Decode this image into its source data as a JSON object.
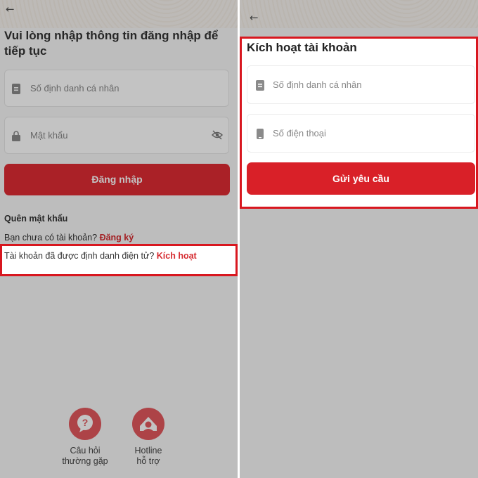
{
  "left": {
    "title": "Vui lòng nhập thông tin đăng nhập để tiếp tục",
    "id_placeholder": "Số định danh cá nhân",
    "password_placeholder": "Mật khẩu",
    "login_button": "Đăng nhập",
    "forgot_password": "Quên mật khẩu",
    "no_account_text": "Bạn chưa có tài khoản?",
    "register_link": "Đăng ký",
    "identified_text": "Tài khoản đã được định danh điện tử?",
    "activate_link": "Kích hoạt",
    "faq_line1": "Câu hỏi",
    "faq_line2": "thường gặp",
    "hotline_line1": "Hotline",
    "hotline_line2": "hỗ trợ"
  },
  "right": {
    "title": "Kích hoạt tài khoản",
    "id_placeholder": "Số định danh cá nhân",
    "phone_placeholder": "Số điện thoại",
    "submit_button": "Gửi yêu cầu"
  },
  "icons": {
    "back": "back-arrow-icon",
    "id_card": "id-card-icon",
    "lock": "lock-icon",
    "eye_off": "eye-off-icon",
    "phone": "phone-icon",
    "faq": "question-bubble-icon",
    "hotline": "headset-icon"
  },
  "colors": {
    "primary_red": "#df2c33",
    "highlight_border": "#d8171f",
    "overlay": "rgba(0,0,0,0.235)"
  }
}
